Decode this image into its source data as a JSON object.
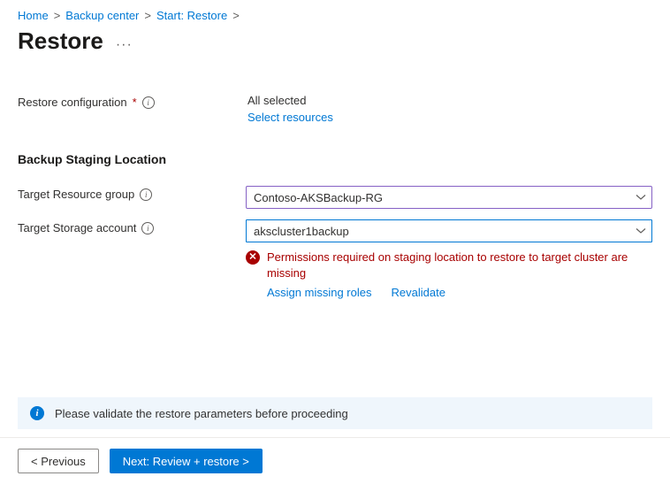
{
  "breadcrumb": {
    "items": [
      "Home",
      "Backup center",
      "Start: Restore"
    ]
  },
  "title": "Restore",
  "restoreConfig": {
    "label": "Restore configuration",
    "value": "All selected",
    "selectLink": "Select resources"
  },
  "stagingSection": {
    "heading": "Backup Staging Location",
    "resourceGroup": {
      "label": "Target Resource group",
      "value": "Contoso-AKSBackup-RG"
    },
    "storageAccount": {
      "label": "Target Storage account",
      "value": "akscluster1backup",
      "error": "Permissions required on staging location to restore to target cluster are missing",
      "assignLink": "Assign missing roles",
      "revalidateLink": "Revalidate"
    }
  },
  "banner": {
    "text": "Please validate the restore parameters before proceeding"
  },
  "footer": {
    "prev": "< Previous",
    "next": "Next: Review + restore >"
  }
}
